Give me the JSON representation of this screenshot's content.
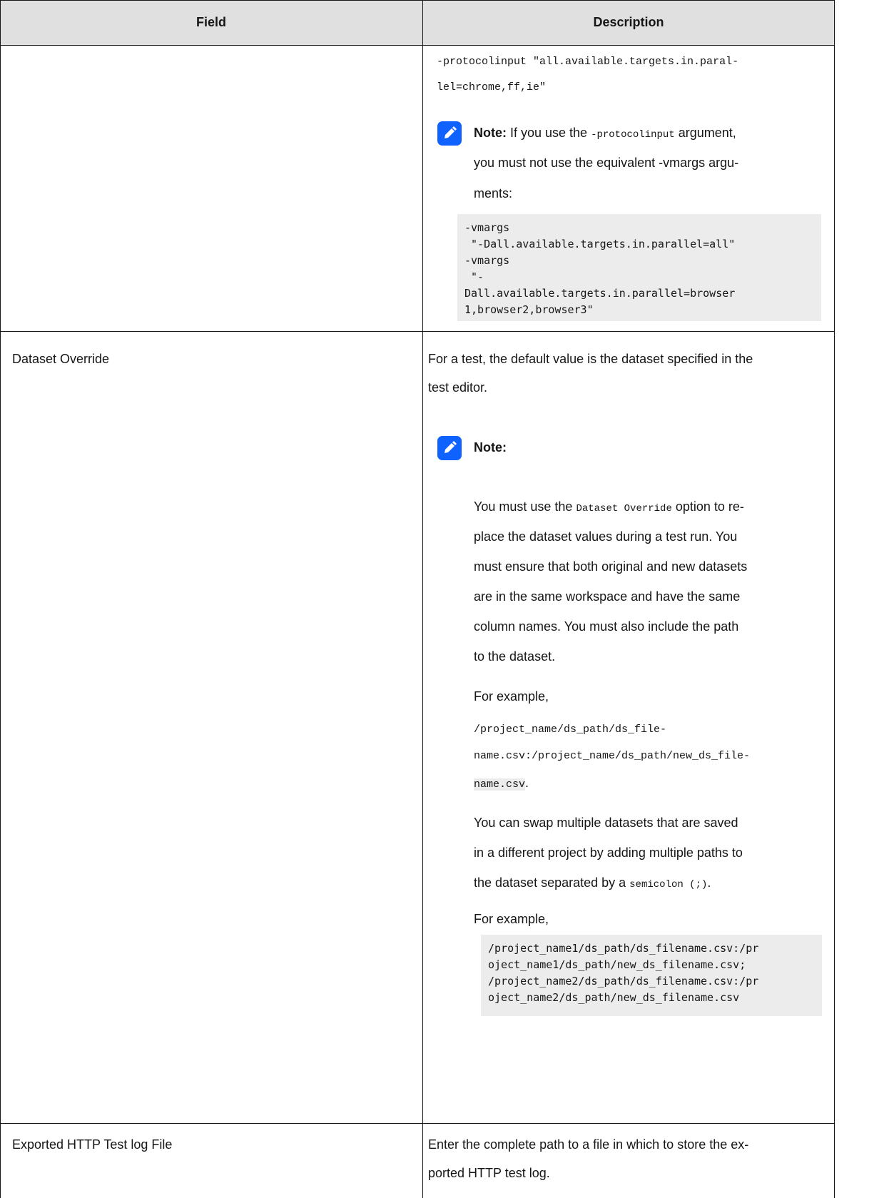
{
  "table": {
    "headers": {
      "field": "Field",
      "description": "Description"
    },
    "row1": {
      "protocol_line1": "-protocolinput \"all.available.targets.in.paral-",
      "protocol_line2": "lel=chrome,ff,ie\"",
      "note_label": "Note:",
      "note_text_a": " If you use the ",
      "note_code": "-protocolinput",
      "note_text_b": " argument,",
      "note_line2": "you must not use the equivalent -vmargs argu-",
      "note_line3": "ments:",
      "code_block": "-vmargs\n \"-Dall.available.targets.in.parallel=all\"\n-vmargs\n \"-\nDall.available.targets.in.parallel=browser\n1,browser2,browser3\""
    },
    "row2": {
      "field": "Dataset Override",
      "desc_line1": "For a test, the default value is the dataset specified in the",
      "desc_line2": "test editor.",
      "note_label": "Note:",
      "para1_a": "You must use the ",
      "para1_code": "Dataset Override",
      "para1_b": " option to re-",
      "para1_l2": "place the dataset values during a test run. You",
      "para1_l3": "must ensure that both original and new datasets",
      "para1_l4": "are in the same workspace and have the same",
      "para1_l5": "column names. You must also include the path",
      "para1_l6": "to the dataset.",
      "example1": "For example,",
      "path_l1": "/project_name/ds_path/ds_file-",
      "path_l2": "name.csv:/project_name/ds_path/new_ds_file-",
      "path_l3": "name.csv",
      "path_end": ".",
      "para2_l1": "You can swap multiple datasets that are saved",
      "para2_l2": "in a different project by adding multiple paths to",
      "para2_l3a": "the dataset separated by a ",
      "para2_code": "semicolon (;)",
      "para2_l3b": ".",
      "example2": "For example,",
      "code_block": "/project_name1/ds_path/ds_filename.csv:/pr\noject_name1/ds_path/new_ds_filename.csv;\n/project_name2/ds_path/ds_filename.csv:/pr\noject_name2/ds_path/new_ds_filename.csv"
    },
    "row3": {
      "field": "Exported HTTP Test log File",
      "desc_line1": "Enter the complete path to a file in which to store the ex-",
      "desc_line2": "ported HTTP test log."
    }
  },
  "icons": {
    "note": "pencil-note-icon"
  },
  "colors": {
    "header_bg": "#e0e0e0",
    "note_icon": "#0f62fe",
    "code_bg": "#ececec"
  }
}
